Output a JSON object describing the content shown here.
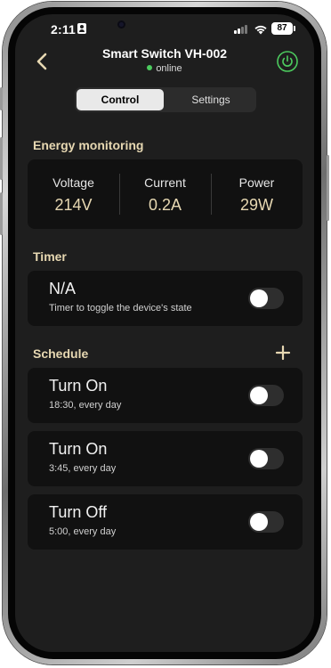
{
  "status_bar": {
    "time": "2:11",
    "battery": "87"
  },
  "header": {
    "title": "Smart Switch VH-002",
    "status": "online",
    "status_color": "#4ccb5e",
    "power_icon_color": "#4ccb5e"
  },
  "tabs": [
    {
      "label": "Control",
      "active": true
    },
    {
      "label": "Settings",
      "active": false
    }
  ],
  "energy": {
    "heading": "Energy monitoring",
    "metrics": [
      {
        "label": "Voltage",
        "value": "214V"
      },
      {
        "label": "Current",
        "value": "0.2A"
      },
      {
        "label": "Power",
        "value": "29W"
      }
    ]
  },
  "timer": {
    "heading": "Timer",
    "title": "N/A",
    "subtitle": "Timer to toggle the device's state",
    "enabled": false
  },
  "schedule": {
    "heading": "Schedule",
    "items": [
      {
        "title": "Turn On",
        "subtitle": "18:30, every day",
        "enabled": false
      },
      {
        "title": "Turn On",
        "subtitle": "3:45, every day",
        "enabled": false
      },
      {
        "title": "Turn Off",
        "subtitle": "5:00, every day",
        "enabled": false
      }
    ]
  },
  "icons": {
    "back": "chevron-left-icon",
    "power": "power-icon",
    "add": "plus-icon"
  },
  "colors": {
    "accent_text": "#e7d8b2",
    "background": "#1e1e1e",
    "card": "#111111"
  }
}
